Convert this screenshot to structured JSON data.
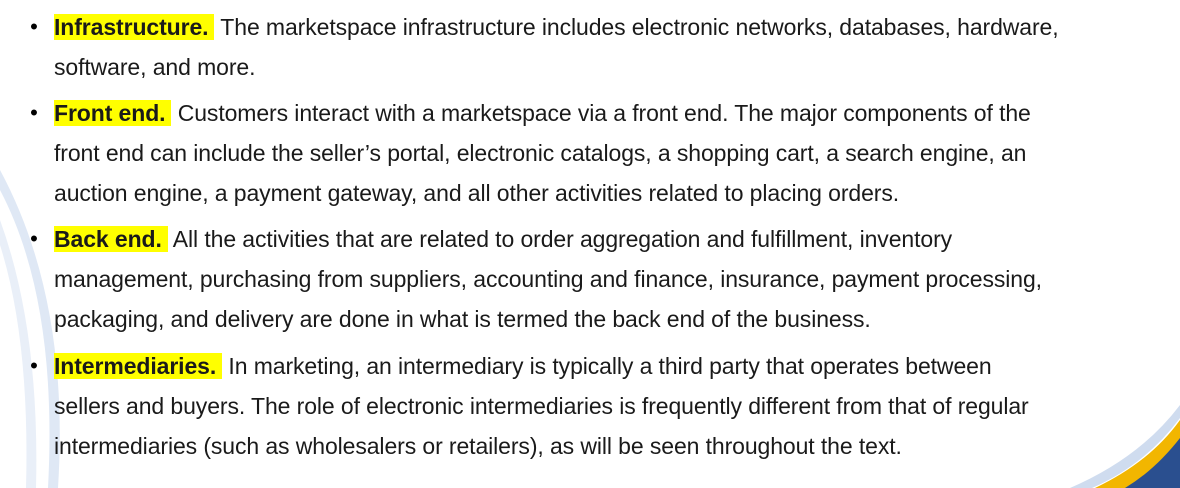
{
  "items": [
    {
      "term": "Infrastructure.",
      "lines": [
        " The marketspace infrastructure includes electronic networks, databases, hardware,",
        "software, and more."
      ]
    },
    {
      "term": "Front end.",
      "lines": [
        " Customers interact with a marketspace via a front end. The major components of the",
        "front end can include the seller’s portal, electronic catalogs, a shopping cart, a search engine, an",
        "auction engine, a payment gateway, and all other activities related to placing orders."
      ]
    },
    {
      "term": "Back end.",
      "lines": [
        " All the activities that are related to order aggregation and fulfillment, inventory",
        "management, purchasing from suppliers, accounting and finance, insurance, payment processing,",
        "packaging, and delivery are done in what is termed the back end of the business."
      ]
    },
    {
      "term": "Intermediaries.",
      "lines": [
        " In marketing, an intermediary is typically a third party that operates between",
        "sellers and buyers. The role of electronic intermediaries is frequently different from that of regular",
        "intermediaries (such as wholesalers or retailers), as will be seen throughout the text."
      ]
    }
  ],
  "bullet_symbol": "•",
  "colors": {
    "highlight": "#ffff00",
    "text": "#1a1a1a",
    "decor_blue": "#cfdcef",
    "decor_accent": "#f2b600",
    "decor_navy": "#2a4f8f"
  }
}
